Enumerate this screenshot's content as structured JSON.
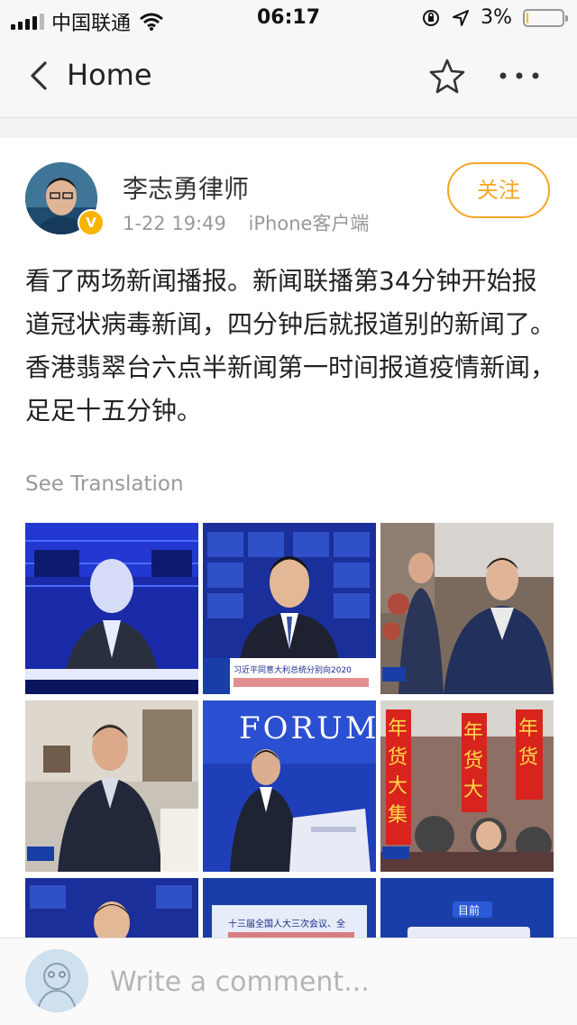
{
  "status_bar": {
    "carrier": "中国联通",
    "time": "06:17",
    "battery": "3%",
    "battery_level": 0.03
  },
  "nav": {
    "back_label": "Home"
  },
  "post": {
    "author": "李志勇律师",
    "timestamp": "1-22 19:49",
    "source": "iPhone客户端",
    "follow_label": "关注",
    "verified_mark": "V",
    "text": "看了两场新闻播报。新闻联播第34分钟开始报道冠状病毒新闻，四分钟后就报道别的新闻了。香港翡翠台六点半新闻第一时间报道疫情新闻，足足十五分钟。",
    "see_translation": "See Translation",
    "images": [
      {
        "caption": ""
      },
      {
        "caption": "习近平同意大利总统分别向2020"
      },
      {
        "caption": ""
      },
      {
        "caption": ""
      },
      {
        "caption": "FORUM"
      },
      {
        "caption": "年货大集"
      },
      {
        "caption": ""
      },
      {
        "caption": "十三届全国人大三次会议、全"
      },
      {
        "caption": "目前"
      }
    ]
  },
  "comment": {
    "placeholder": "Write a comment..."
  },
  "colors": {
    "accent": "#f5a623",
    "badge": "#f9b400",
    "muted": "#999999"
  }
}
